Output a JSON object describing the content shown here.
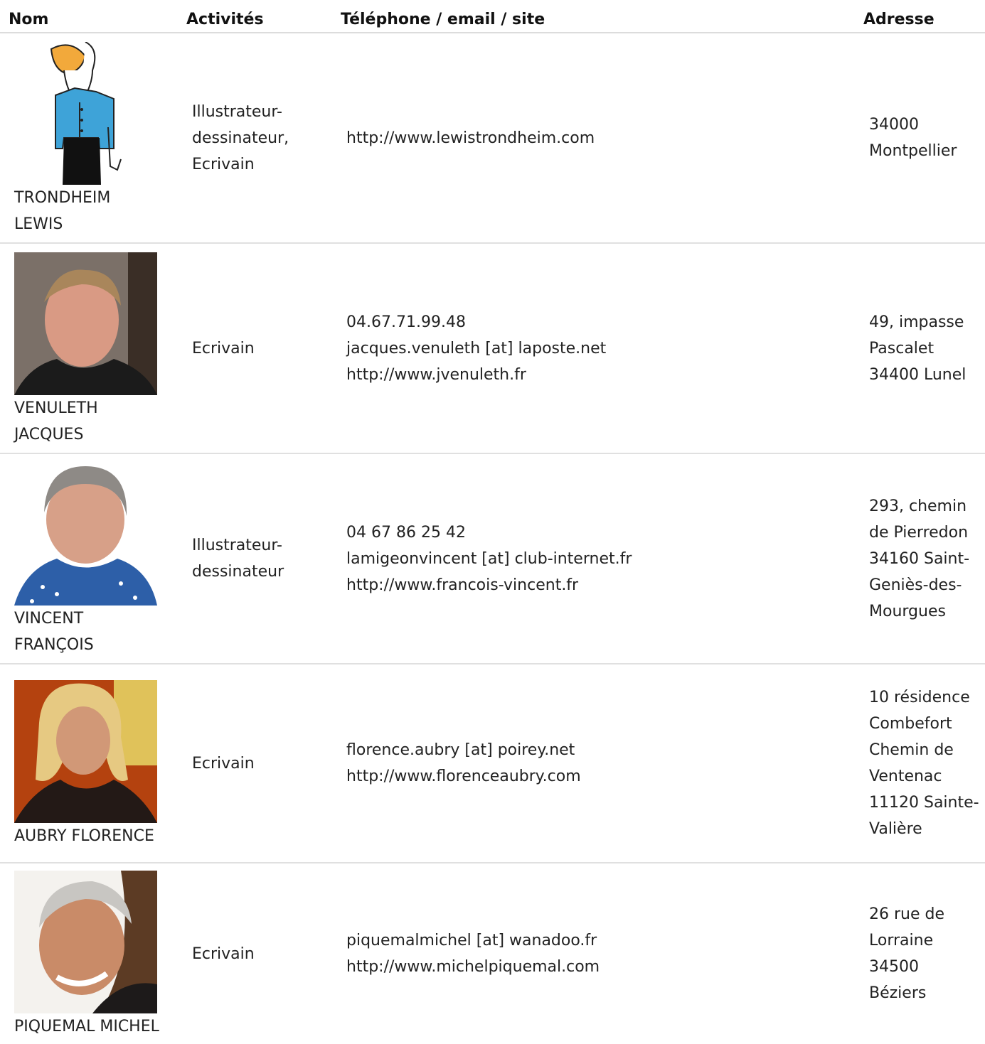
{
  "headers": {
    "nom": "Nom",
    "activites": "Activités",
    "contact": "Téléphone / email / site",
    "adresse": "Adresse"
  },
  "rows": [
    {
      "name_l1": "TRONDHEIM",
      "name_l2": "LEWIS",
      "photo_icon": "cartoon-bird-portrait",
      "activities": [
        "Illustrateur-",
        "dessinateur,",
        "Ecrivain"
      ],
      "phone": "",
      "email": "",
      "site": "http://www.lewistrondheim.com",
      "address": "34000 Montpellier"
    },
    {
      "name_l1": "VENULETH",
      "name_l2": "JACQUES",
      "photo_icon": "man-portrait",
      "activities": [
        "Ecrivain"
      ],
      "phone": "04.67.71.99.48",
      "email": "jacques.venuleth [at] laposte.net",
      "site": "http://www.jvenuleth.fr",
      "address": "49, impasse Pascalet 34400 Lunel"
    },
    {
      "name_l1": "VINCENT",
      "name_l2": "FRANÇOIS",
      "photo_icon": "man-portrait",
      "activities": [
        "Illustrateur-",
        "dessinateur"
      ],
      "phone": "04 67 86 25 42",
      "email": "lamigeonvincent [at] club-internet.fr",
      "site": "http://www.francois-vincent.fr",
      "address": "293, chemin de Pierredon 34160 Saint-Geniès-des-Mourgues"
    },
    {
      "name_l1": "AUBRY FLORENCE",
      "name_l2": "",
      "photo_icon": "woman-portrait",
      "activities": [
        "Ecrivain"
      ],
      "phone": "",
      "email": "florence.aubry [at] poirey.net",
      "site": "http://www.florenceaubry.com",
      "address": "10 résidence Combefort Chemin de Ventenac 11120 Sainte-Valière"
    },
    {
      "name_l1": "PIQUEMAL MICHEL",
      "name_l2": "",
      "photo_icon": "man-portrait",
      "activities": [
        "Ecrivain"
      ],
      "phone": "",
      "email": "piquemalmichel [at] wanadoo.fr",
      "site": "http://www.michelpiquemal.com",
      "address": "26 rue de Lorraine 34500 Béziers"
    }
  ]
}
